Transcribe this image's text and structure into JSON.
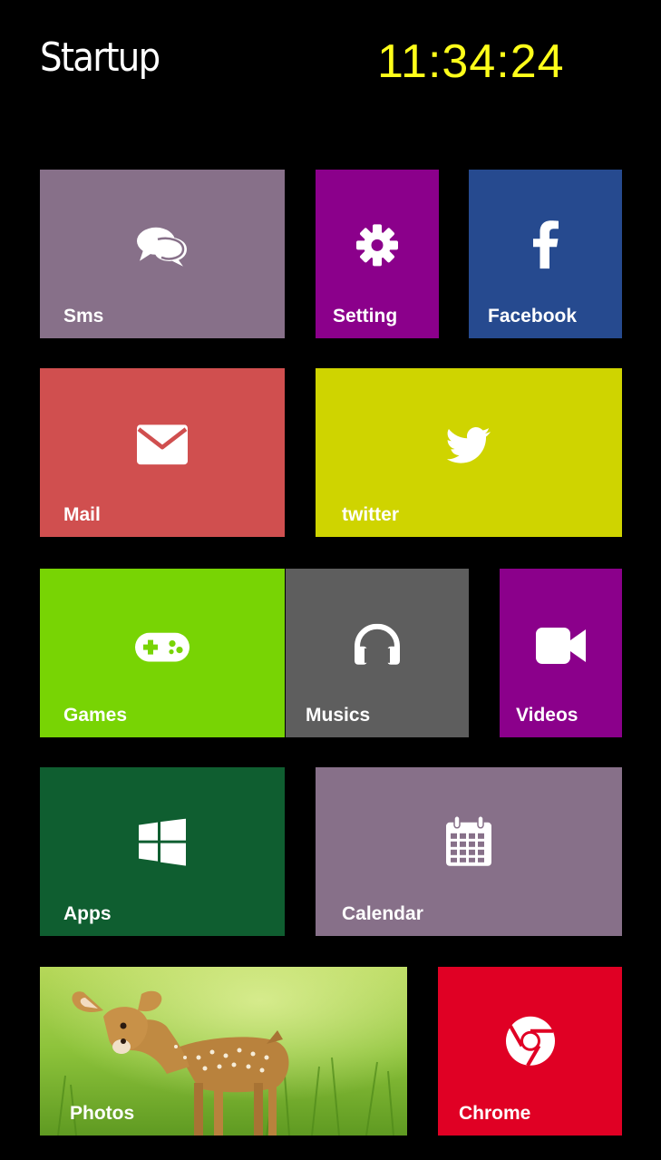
{
  "header": {
    "title": "Startup",
    "clock": "11:34:24",
    "clock_color": "#ffff1a"
  },
  "tiles": [
    {
      "name": "tile-sms",
      "label": "Sms",
      "icon": "chat-bubbles-icon",
      "color": "#877089"
    },
    {
      "name": "tile-setting",
      "label": "Setting",
      "icon": "gear-icon",
      "color": "#8b008b"
    },
    {
      "name": "tile-facebook",
      "label": "Facebook",
      "icon": "facebook-icon",
      "color": "#264a8f"
    },
    {
      "name": "tile-mail",
      "label": "Mail",
      "icon": "envelope-icon",
      "color": "#d04f4f"
    },
    {
      "name": "tile-twitter",
      "label": "twitter",
      "icon": "twitter-bird-icon",
      "color": "#cfd400"
    },
    {
      "name": "tile-games",
      "label": "Games",
      "icon": "gamepad-icon",
      "color": "#78d404"
    },
    {
      "name": "tile-musics",
      "label": "Musics",
      "icon": "headphones-icon",
      "color": "#5e5e5e"
    },
    {
      "name": "tile-videos",
      "label": "Videos",
      "icon": "video-camera-icon",
      "color": "#8b008b"
    },
    {
      "name": "tile-apps",
      "label": "Apps",
      "icon": "windows-logo-icon",
      "color": "#0f5e30"
    },
    {
      "name": "tile-calendar",
      "label": "Calendar",
      "icon": "calendar-icon",
      "color": "#877089"
    },
    {
      "name": "tile-photos",
      "label": "Photos",
      "icon": "deer-photo",
      "color": "#9cc43c"
    },
    {
      "name": "tile-chrome",
      "label": "Chrome",
      "icon": "chrome-icon",
      "color": "#e00024"
    }
  ]
}
